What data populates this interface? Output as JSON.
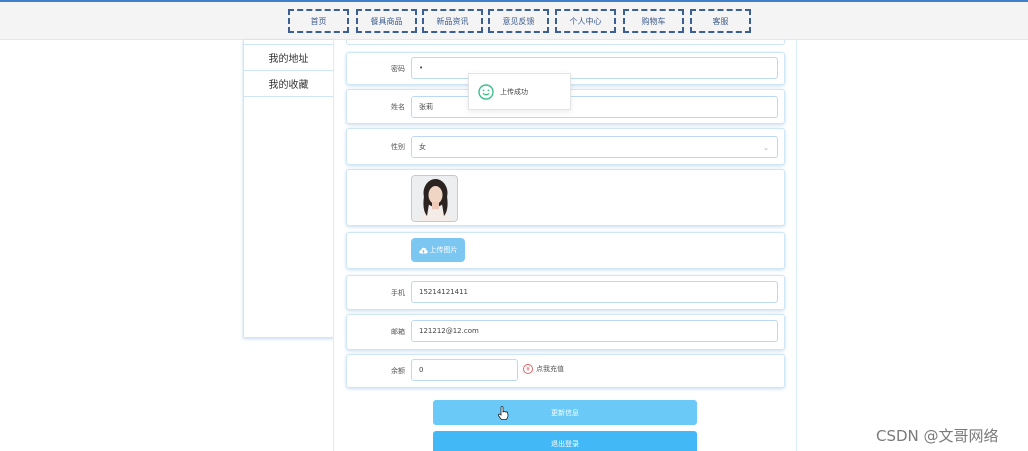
{
  "nav": {
    "items": [
      {
        "label": "首页"
      },
      {
        "label": "餐具商品"
      },
      {
        "label": "新品资讯"
      },
      {
        "label": "意见反馈"
      },
      {
        "label": "个人中心"
      },
      {
        "label": "购物车"
      },
      {
        "label": "客服"
      }
    ]
  },
  "sidebar": {
    "items": [
      {
        "label": "我的地址"
      },
      {
        "label": "我的收藏"
      }
    ]
  },
  "form": {
    "password": {
      "label": "密码",
      "value": "•"
    },
    "name": {
      "label": "姓名",
      "value": "张莉"
    },
    "gender": {
      "label": "性别",
      "value": "女",
      "caret": "⌄"
    },
    "upload_label": "上传图片",
    "phone": {
      "label": "手机",
      "value": "15214121411"
    },
    "email": {
      "label": "邮箱",
      "value": "121212@12.com"
    },
    "balance": {
      "label": "余额",
      "value": "0",
      "recharge_icon": "¥",
      "recharge_label": "点我充值"
    },
    "update_label": "更新信息",
    "logout_label": "退出登录"
  },
  "toast": {
    "message": "上传成功"
  },
  "colors": {
    "accent": "#3f7fc9",
    "nav_border": "#3b5e93",
    "button_light": "#6ac9f7",
    "button_dark": "#42b9f6",
    "upload_button": "#7cc6f2",
    "toast_icon": "#3cc08a"
  },
  "watermark": "CSDN @文哥网络"
}
